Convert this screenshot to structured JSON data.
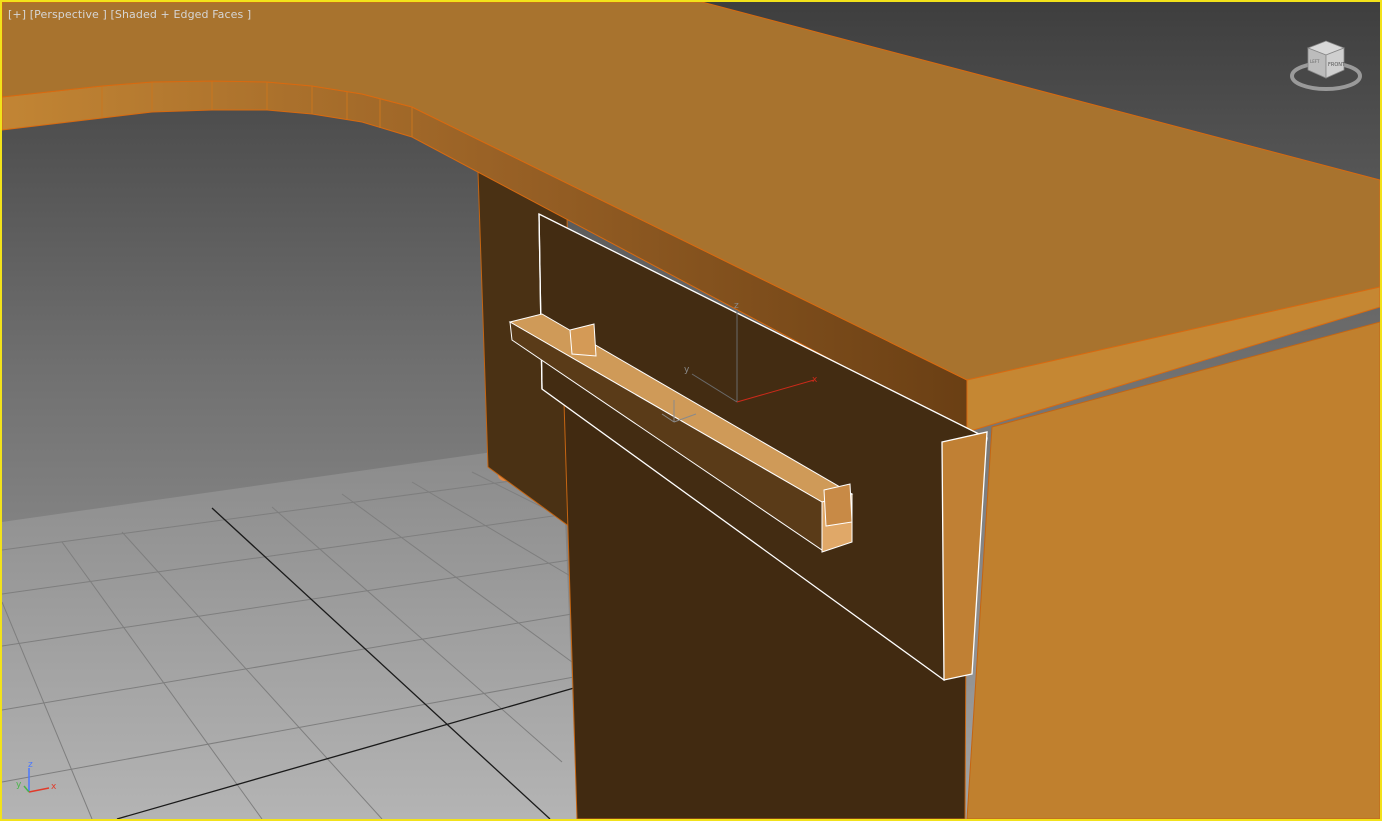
{
  "viewport": {
    "menu_label": "[+]",
    "view_label": "[Perspective ]",
    "shading_label": "[Shaded + Edged Faces ]"
  },
  "viewcube": {
    "face_front": "FRONT",
    "face_left": "LEFT"
  },
  "gizmo": {
    "axis_x": "x",
    "axis_y": "y",
    "axis_z": "z"
  },
  "tripod": {
    "axis_x": "x",
    "axis_y": "y",
    "axis_z": "z"
  },
  "colors": {
    "selection_border": "#f2e21a",
    "wood_top": "#a8732e",
    "wood_side": "#c0802e",
    "wood_dark": "#432c12",
    "handle": "#c48d4e",
    "edge": "#d86a10",
    "selected_edge": "#ffffff",
    "grid_floor": "#9e9e9e",
    "axis_x": "#e03b2a",
    "axis_y": "#49b649",
    "axis_z": "#4a78ff"
  }
}
